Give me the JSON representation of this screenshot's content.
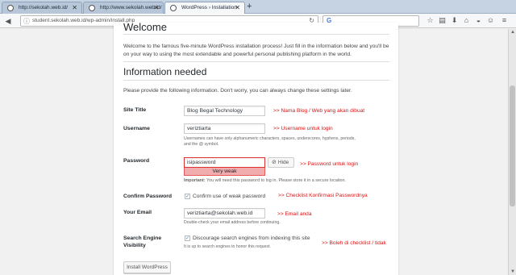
{
  "browser": {
    "tabs": [
      {
        "label": "http://sekolah.web.id/"
      },
      {
        "label": "http://www.sekolah.web.id/"
      },
      {
        "label": "WordPress › Installation"
      }
    ],
    "url": "student.sekolah.web.id/wp-admin/install.php"
  },
  "page": {
    "welcome_title": "Welcome",
    "intro": "Welcome to the famous five-minute WordPress installation process! Just fill in the information below and you'll be on your way to using the most extendable and powerful personal publishing platform in the world.",
    "info_title": "Information needed",
    "info_sub": "Please provide the following information. Don't worry, you can always change these settings later."
  },
  "form": {
    "site_title": {
      "label": "Site Title",
      "value": "Blog Begal Technology"
    },
    "username": {
      "label": "Username",
      "value": "veriztiarta",
      "desc": "Usernames can have only alphanumeric characters, spaces, underscores, hyphens, periods, and the @ symbol."
    },
    "password": {
      "label": "Password",
      "value": "isipassword",
      "strength": "Very weak",
      "hide_label": "Hide",
      "important_label": "Important:",
      "important_text": " You will need this password to log in. Please store it in a secure location."
    },
    "confirm_password": {
      "label": "Confirm Password",
      "checkbox_label": "Confirm use of weak password",
      "checked": true
    },
    "email": {
      "label": "Your Email",
      "value": "veriztiarta@sekolah.web.id",
      "desc": "Double-check your email address before continuing."
    },
    "search_visibility": {
      "label_line1": "Search Engine",
      "label_line2": "Visibility",
      "checkbox_label": "Discourage search engines from indexing this site",
      "desc": "It is up to search engines to honor this request.",
      "checked": true
    },
    "submit_label": "Install WordPress"
  },
  "annotations": {
    "site_title": ">> Nama Blog / Web yang akan dibuat",
    "username": ">> Username untuk login",
    "password": ">> Password untuk login",
    "confirm": ">> Checklist Konfirmasi Passwordnya",
    "email": ">> Email anda",
    "search": ">> Boleh di checklist / tidak"
  },
  "colors": {
    "annotation": "#dd1111",
    "weak_password": "#f1adad"
  }
}
